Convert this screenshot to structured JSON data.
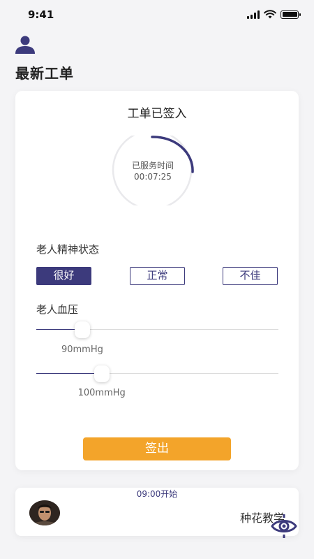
{
  "status_bar": {
    "time": "9:41"
  },
  "header": {
    "title": "最新工单"
  },
  "order": {
    "status_title": "工单已签入",
    "timer": {
      "label": "已服务时间",
      "value": "00:07:25"
    },
    "mood": {
      "label": "老人精神状态",
      "options": [
        "很好",
        "正常",
        "不佳"
      ],
      "selected": "很好"
    },
    "blood_pressure": {
      "label": "老人血压",
      "sliders": [
        {
          "value_text": "90mmHg",
          "fraction": 0.19
        },
        {
          "value_text": "100mmHg",
          "fraction": 0.27
        }
      ]
    },
    "signout_label": "签出"
  },
  "next_task": {
    "start_time": "09:00开始",
    "course_name": "种花教学"
  },
  "colors": {
    "accent": "#3c3a7c",
    "button": "#f3a42a",
    "background": "#f4f4f6"
  }
}
